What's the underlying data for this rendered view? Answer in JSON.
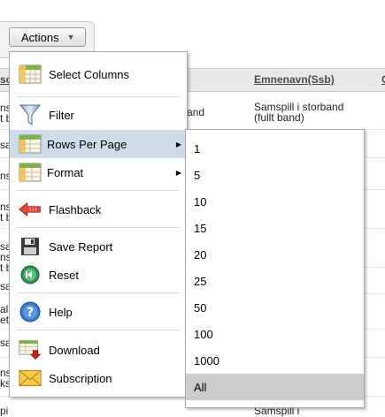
{
  "toolbar": {
    "actions_label": "Actions"
  },
  "report": {
    "columns": [
      {
        "label": "sc"
      },
      {
        "label": "Emnenavn(Ssb)"
      },
      {
        "label": "C"
      }
    ],
    "col2_rows": [
      "and",
      "Samspill i storband\n(fullt band)",
      "Samspill i"
    ],
    "left_fragments": [
      "ns",
      "t b",
      "sa",
      "ns",
      "ns",
      "t b",
      "sa",
      "ns",
      "t b",
      "sa",
      "al",
      "et",
      "sa",
      "ns",
      "ks",
      "pill i"
    ]
  },
  "menu": {
    "items": [
      {
        "label": "Select Columns",
        "icon": "table-columns-icon"
      },
      {
        "label": "Filter",
        "icon": "funnel-icon"
      },
      {
        "label": "Rows Per Page",
        "icon": "table-rows-icon"
      },
      {
        "label": "Format",
        "icon": "table-format-icon"
      },
      {
        "label": "Flashback",
        "icon": "back-arrow-icon"
      },
      {
        "label": "Save Report",
        "icon": "floppy-disk-icon"
      },
      {
        "label": "Reset",
        "icon": "reset-icon"
      },
      {
        "label": "Help",
        "icon": "help-icon"
      },
      {
        "label": "Download",
        "icon": "download-icon"
      },
      {
        "label": "Subscription",
        "icon": "envelope-icon"
      }
    ]
  },
  "rows_per_page": {
    "options": [
      "1",
      "5",
      "10",
      "15",
      "20",
      "25",
      "50",
      "100",
      "1000",
      "All"
    ],
    "selected": "All"
  },
  "colors": {
    "active_item_bg": "#cfdbe8",
    "selected_option_bg": "#cdcdcd",
    "header_link": "#4a4a4a"
  }
}
